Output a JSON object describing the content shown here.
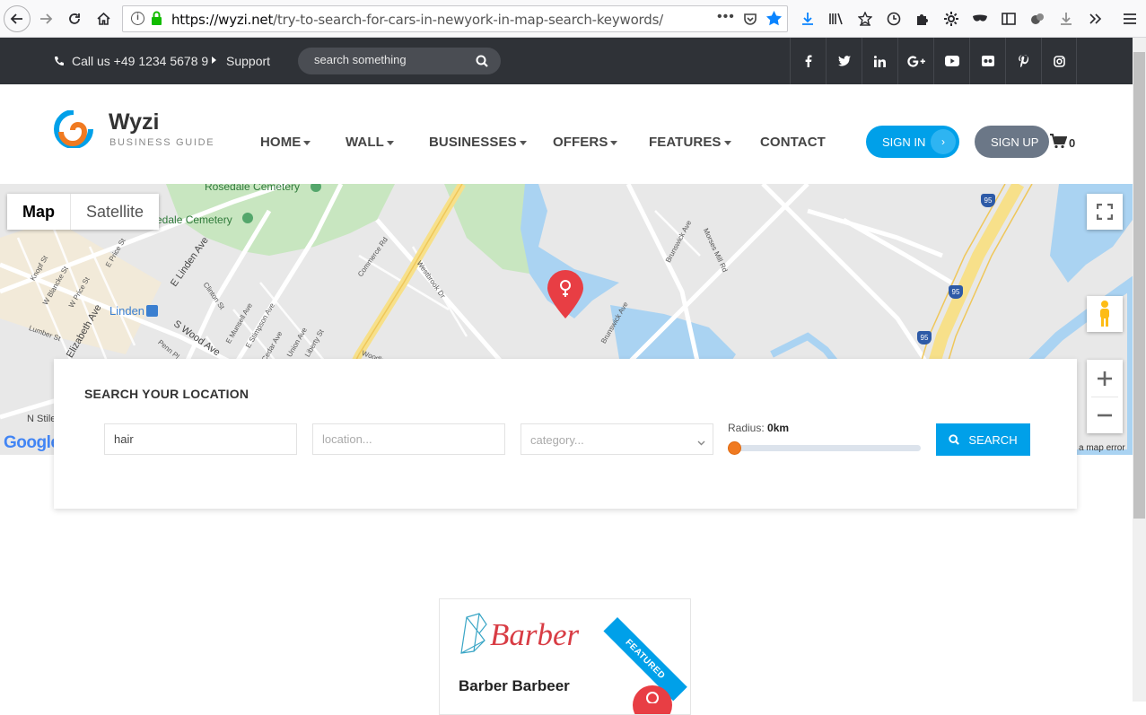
{
  "browser": {
    "url_host": "https://wyzi.net",
    "url_path": "/try-to-search-for-cars-in-newyork-in-map-search-keywords/"
  },
  "topbar": {
    "phone": "Call us +49 1234 5678 9",
    "support": "Support",
    "search_placeholder": "search something",
    "social": [
      "f",
      "t",
      "in",
      "G+",
      "yt",
      "fl",
      "p",
      "ig"
    ]
  },
  "brand": {
    "name": "Wyzi",
    "tagline": "BUSINESS GUIDE"
  },
  "nav": {
    "items": [
      {
        "label": "HOME",
        "dropdown": true
      },
      {
        "label": "WALL",
        "dropdown": true
      },
      {
        "label": "BUSINESSES",
        "dropdown": true
      },
      {
        "label": "OFFERS",
        "dropdown": true
      },
      {
        "label": "FEATURES",
        "dropdown": true
      },
      {
        "label": "CONTACT",
        "dropdown": false
      }
    ],
    "sign_in": "SIGN IN",
    "sign_up": "SIGN UP",
    "cart_count": "0"
  },
  "map": {
    "type_map": "Map",
    "type_satellite": "Satellite",
    "google": "Google",
    "report": "a map error",
    "labels": {
      "rosedale1": "Rosedale Cemetery",
      "rosedale2": "edale Cemetery",
      "linden": "Linden",
      "e_linden": "E Linden Ave",
      "s_wood": "S Wood Ave",
      "elizabeth": "Elizabeth Ave",
      "brunswick1": "Brunswick Ave",
      "brunswick2": "Brunswick Ave",
      "morses": "Morses Mill Rd",
      "westbrook": "Westbrook Dr",
      "commerce": "Commerce Rd",
      "clinton": "Clinton St",
      "munsell": "E Munsell Ave",
      "stimpson": "E Stimpson Ave",
      "cedar": "Cedar Ave",
      "union": "Union Ave",
      "liberty": "Liberty St",
      "stiles": "N Stiles",
      "price": "W Price St",
      "eprice": "E Price St",
      "blancke": "W Blancke St",
      "knopf": "Knopf St",
      "lumber": "Lumber St",
      "woodlawn": "Woodlaw",
      "penn": "Penn Pl",
      "i95a": "95",
      "i95b": "95",
      "i95c": "95"
    }
  },
  "search": {
    "title": "SEARCH YOUR LOCATION",
    "keyword_value": "hair",
    "location_placeholder": "location...",
    "category_placeholder": "category...",
    "radius_label": "Radius:",
    "radius_value": "0km",
    "radius_fraction": 0,
    "button": "SEARCH"
  },
  "listing": {
    "logo_text": "Barber",
    "title": "Barber Barbeer",
    "ribbon": "FEATURED"
  },
  "colors": {
    "accent": "#00a0e9",
    "topbar": "#2f3237",
    "signup": "#6b7787",
    "pin": "#e83e44",
    "slider": "#f07a21"
  }
}
